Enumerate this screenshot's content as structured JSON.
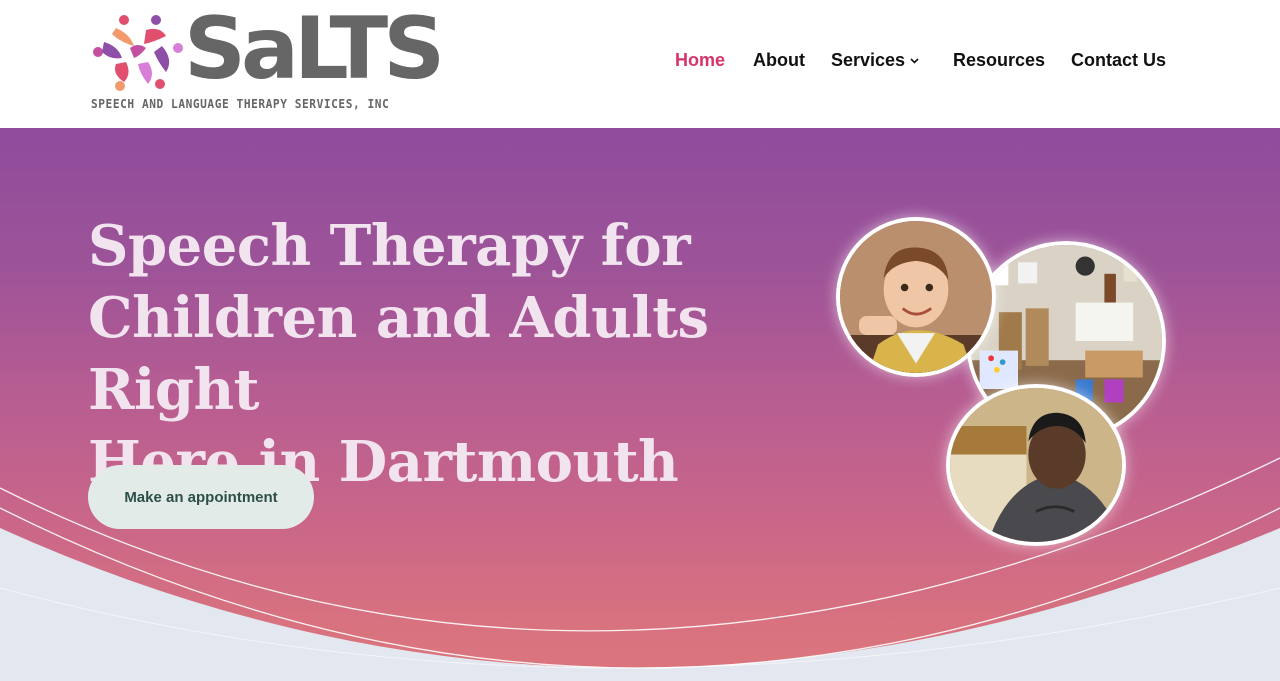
{
  "brand": {
    "wordmark": "SaLTS",
    "tagline": "SPEECH AND LANGUAGE THERAPY SERVICES, INC",
    "logo_colors": [
      "#e0506e",
      "#8e4fa8",
      "#f29a6b",
      "#d77fd8",
      "#c34fa0"
    ]
  },
  "nav": {
    "items": [
      {
        "label": "Home",
        "active": true
      },
      {
        "label": "About",
        "active": false
      },
      {
        "label": "Services",
        "active": false
      },
      {
        "label": "Resources",
        "active": false
      },
      {
        "label": "Contact Us",
        "active": false
      }
    ],
    "active_color": "#d6336c"
  },
  "hero": {
    "title_line1": "Speech Therapy for",
    "title_line2": "Children and Adults Right",
    "title_line3": "Here in Dartmouth",
    "cta_label": "Make an appointment",
    "gradient_top": "#8f4c9c",
    "gradient_bottom": "#dc767c"
  },
  "icons": {
    "services_dropdown": "chevron-down-icon"
  }
}
